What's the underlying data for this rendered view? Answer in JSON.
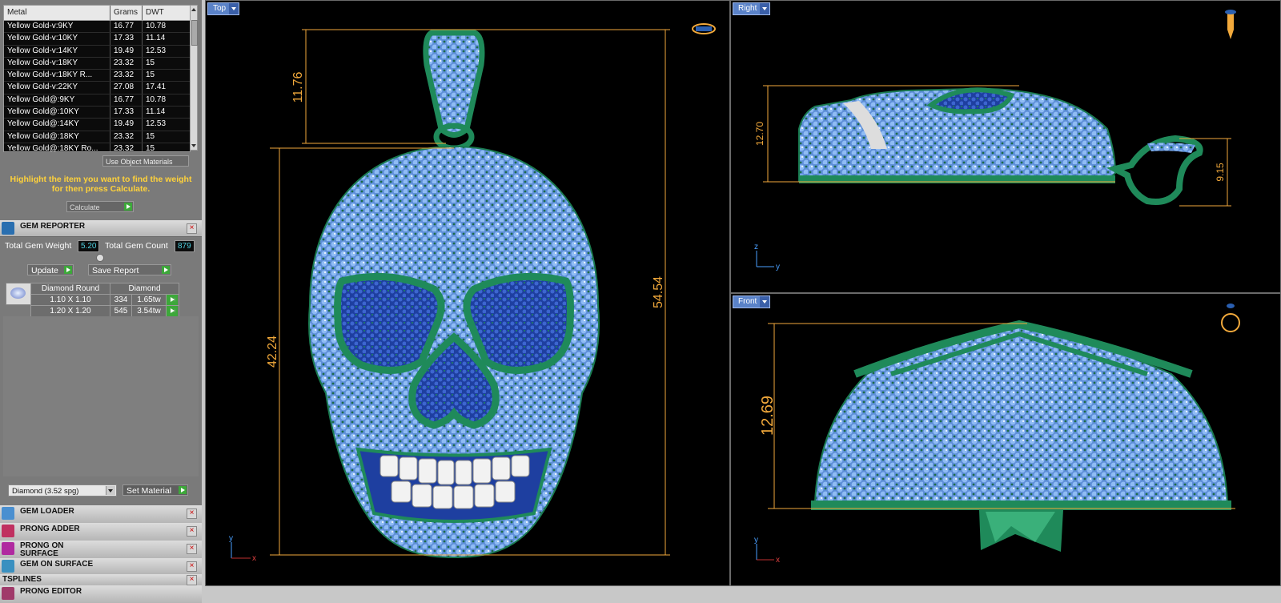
{
  "metal_table": {
    "headers": [
      "Metal",
      "Grams",
      "DWT"
    ],
    "rows": [
      {
        "metal": "Yellow Gold-v:9KY",
        "grams": "16.77",
        "dwt": "10.78"
      },
      {
        "metal": "Yellow Gold-v:10KY",
        "grams": "17.33",
        "dwt": "11.14"
      },
      {
        "metal": "Yellow Gold-v:14KY",
        "grams": "19.49",
        "dwt": "12.53"
      },
      {
        "metal": "Yellow Gold-v:18KY",
        "grams": "23.32",
        "dwt": "15"
      },
      {
        "metal": "Yellow Gold-v:18KY R...",
        "grams": "23.32",
        "dwt": "15"
      },
      {
        "metal": "Yellow Gold-v:22KY",
        "grams": "27.08",
        "dwt": "17.41"
      },
      {
        "metal": "Yellow Gold@:9KY",
        "grams": "16.77",
        "dwt": "10.78"
      },
      {
        "metal": "Yellow Gold@:10KY",
        "grams": "17.33",
        "dwt": "11.14"
      },
      {
        "metal": "Yellow Gold@:14KY",
        "grams": "19.49",
        "dwt": "12.53"
      },
      {
        "metal": "Yellow Gold@:18KY",
        "grams": "23.32",
        "dwt": "15"
      },
      {
        "metal": "Yellow Gold@:18KY Ro...",
        "grams": "23.32",
        "dwt": "15"
      }
    ]
  },
  "use_object_materials": "Use Object Materials",
  "hint": "Highlight the item you want to find the weight for then press Calculate.",
  "calculate_label": "Calculate",
  "gem_reporter": {
    "title": "GEM REPORTER",
    "total_weight_label": "Total Gem Weight",
    "total_weight_value": "5.20",
    "total_count_label": "Total Gem Count",
    "total_count_value": "879",
    "update_label": "Update",
    "save_report_label": "Save Report",
    "table_headers": [
      "Diamond Round",
      "Diamond"
    ],
    "rows": [
      {
        "size": "1.10 X 1.10",
        "count": "334",
        "weight": "1.65tw"
      },
      {
        "size": "1.20 X 1.20",
        "count": "545",
        "weight": "3.54tw"
      }
    ],
    "material_value": "Diamond    (3.52 spg)",
    "set_material_label": "Set Material"
  },
  "sections": [
    {
      "title": "GEM LOADER"
    },
    {
      "title": "PRONG ADDER"
    },
    {
      "title": "PRONG ON SURFACE"
    },
    {
      "title": "GEM ON SURFACE"
    },
    {
      "title": "TSPLINES"
    },
    {
      "title": "PRONG EDITOR"
    }
  ],
  "viewports": {
    "top": {
      "label": "Top",
      "dims": [
        "11.76",
        "42.24",
        "54.54"
      ],
      "axis_y": "y",
      "axis_x": "x"
    },
    "right": {
      "label": "Right",
      "dims": [
        "12.70",
        "9.15"
      ],
      "axis_z": "z",
      "axis_y": "y"
    },
    "front": {
      "label": "Front",
      "dims": [
        "12.69"
      ],
      "axis_y": "y",
      "axis_x": "x"
    }
  },
  "colors": {
    "accent": "#f2a93b",
    "gem": "#7fb0f0",
    "metal": "#1f8a5a",
    "viewport_bg": "#000000"
  }
}
